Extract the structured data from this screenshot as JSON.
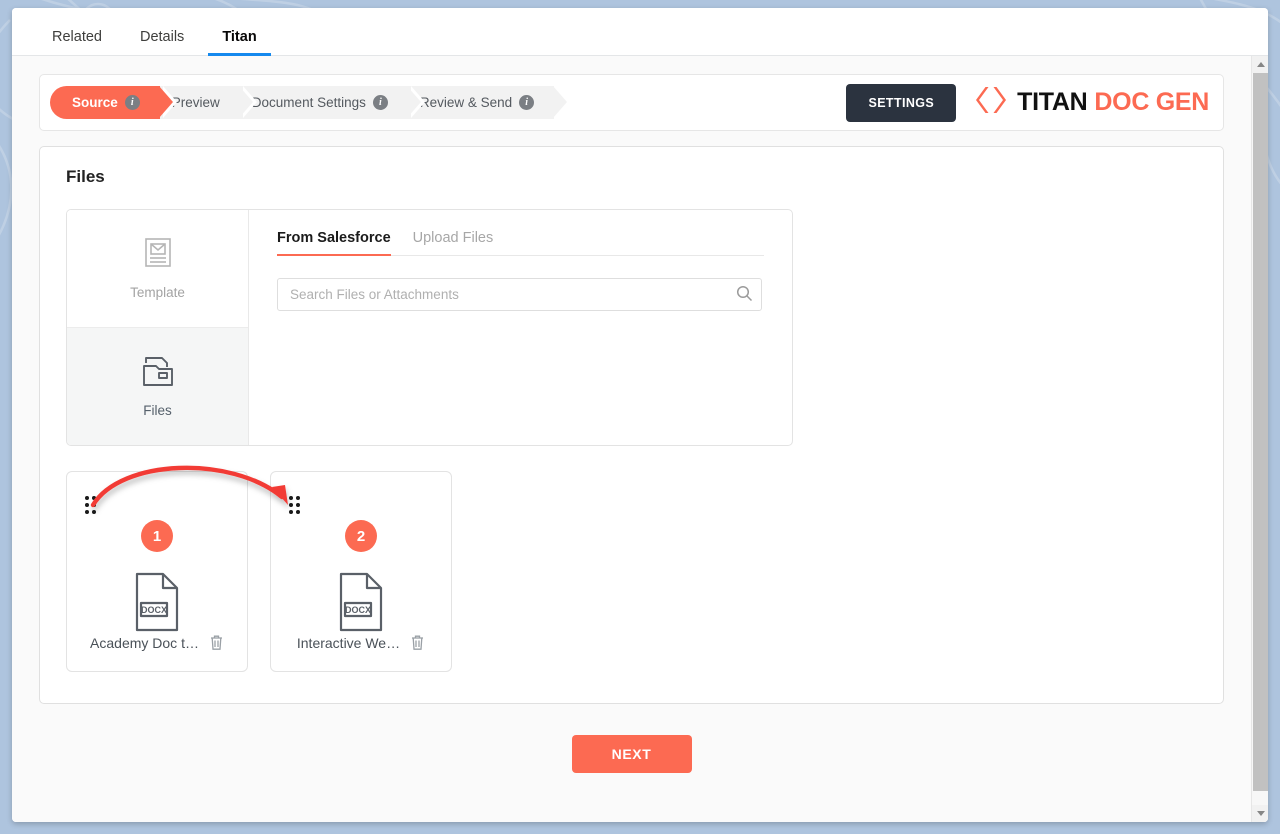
{
  "window": {
    "tabs": [
      {
        "label": "Related",
        "active": false
      },
      {
        "label": "Details",
        "active": false
      },
      {
        "label": "Titan",
        "active": true
      }
    ]
  },
  "stepper": {
    "steps": [
      {
        "label": "Source",
        "active": true,
        "has_info": true
      },
      {
        "label": "Preview",
        "active": false,
        "has_info": false
      },
      {
        "label": "Document Settings",
        "active": false,
        "has_info": true
      },
      {
        "label": "Review & Send",
        "active": false,
        "has_info": true
      }
    ],
    "settings_button": "SETTINGS",
    "brand": {
      "icon": "titan-chevrons-icon",
      "primary": "TITAN",
      "secondary": "DOC GEN"
    }
  },
  "files_section": {
    "title": "Files",
    "source_rail": [
      {
        "label": "Template",
        "icon": "template-envelope-icon",
        "selected": false
      },
      {
        "label": "Files",
        "icon": "folder-icon",
        "selected": true
      }
    ],
    "panel_tabs": [
      {
        "label": "From Salesforce",
        "active": true
      },
      {
        "label": "Upload Files",
        "active": false
      }
    ],
    "search": {
      "placeholder": "Search Files or Attachments",
      "value": "",
      "icon": "search-icon"
    },
    "selected_files": [
      {
        "order": "1",
        "name": "Academy Doc t…",
        "file_type": "DOCX",
        "drag_handle_icon": "drag-handle-icon",
        "delete_icon": "trash-icon"
      },
      {
        "order": "2",
        "name": "Interactive We…",
        "file_type": "DOCX",
        "drag_handle_icon": "drag-handle-icon",
        "delete_icon": "trash-icon"
      }
    ]
  },
  "footer": {
    "next_button": "NEXT"
  },
  "scrollbar": {
    "up_icon": "scroll-up-arrow-icon",
    "down_icon": "scroll-down-arrow-icon"
  },
  "colors": {
    "accent": "#fc6a52",
    "tab_underline": "#1589ee",
    "settings_bg": "#2b333f",
    "background": "#aec4de"
  }
}
